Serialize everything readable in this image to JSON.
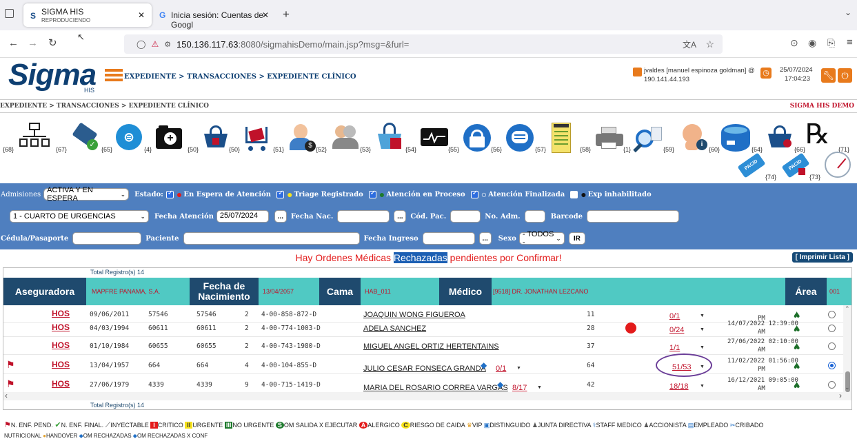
{
  "browser": {
    "tabs": [
      {
        "title": "SIGMA HIS",
        "subtitle": "REPRODUCIENDO"
      },
      {
        "title": "Inicia sesión: Cuentas de Googl"
      }
    ],
    "url_host": "150.136.117.63",
    "url_rest": ":8080/sigmahisDemo/main.jsp?msg=&furl="
  },
  "app": {
    "logo": "Sigma",
    "logo_sub": "HIS",
    "header_breadcrumb": "EXPEDIENTE > TRANSACCIONES > EXPEDIENTE CLÍNICO",
    "user_line1": "jvaldes [manuel espinoza goldman] @",
    "user_line2": "190.141.44.193",
    "date": "25/07/2024",
    "time": "17:04:23",
    "sub_breadcrumb": "EXPEDIENTE > TRANSACCIONES > EXPEDIENTE CLÍNICO",
    "demo_label": "SIGMA HIS DEMO"
  },
  "toolbar": {
    "codes": [
      "{68}",
      "{67}",
      "{65}",
      "{4}",
      "{50}",
      "{50}",
      "{51}",
      "{52}",
      "{53}",
      "{54}",
      "{55}",
      "{56}",
      "{57}",
      "{58}",
      "{1}",
      "{59}",
      "{60}",
      "{64}",
      "{66}",
      "{71}",
      "{74}",
      "{73}"
    ]
  },
  "filters": {
    "admisiones_label": "Admisiones",
    "admisiones_value": "ACTIVA Y EN ESPERA",
    "estado_label": "Estado:",
    "estado_items": [
      "En Espera de Atención",
      "Triage Registrado",
      "Atención en Proceso",
      "Atención Finalizada",
      "Exp inhabilitado"
    ],
    "area_value": "1 - CUARTO DE URGENCIAS",
    "fecha_atencion_label": "Fecha Atención",
    "fecha_atencion_value": "25/07/2024",
    "fecha_nac_label": "Fecha Nac.",
    "cod_pac_label": "Cód. Pac.",
    "no_adm_label": "No. Adm.",
    "barcode_label": "Barcode",
    "cedula_label": "Cédula/Pasaporte",
    "paciente_label": "Paciente",
    "fecha_ingreso_label": "Fecha Ingreso",
    "sexo_label": "Sexo",
    "sexo_value": "- TODOS -",
    "ir_label": "IR",
    "ellipsis": "..."
  },
  "alert": {
    "before": "Hay Ordenes Médicas ",
    "highlight": "Rechazadas",
    "after": " pendientes por Confirmar!"
  },
  "print_label": "[ Imprimir Lista ]",
  "table": {
    "total_top": "Total Registro(s) 14",
    "total_bottom": "Total Registro(s) 14",
    "head": {
      "aseguradora_label": "Aseguradora",
      "aseguradora_value": "MAPFRE PANAMA, S.A.",
      "fecha_label": "Fecha de Nacimiento",
      "fecha_value": "13/04/2057",
      "cama_label": "Cama",
      "cama_value": "HAB_011",
      "medico_label": "Médico",
      "medico_value": "[9518] DR. JONATHAN LEZCANO",
      "area_label": "Área",
      "area_value": "001"
    },
    "rows": [
      {
        "tipo": "HOS",
        "fecha": "09/06/2011",
        "cod": "57546",
        "adm": "57546",
        "n": "2",
        "cedula": "4-00-858-872-D",
        "nombre": "JOAQUIN WONG FIGUEROA",
        "cama": "11",
        "orden": "0/1",
        "fecha_orden": "",
        "fecha_orden2": "PM",
        "flag": false,
        "red_dot": false,
        "selected": false
      },
      {
        "tipo": "HOS",
        "fecha": "04/03/1994",
        "cod": "60611",
        "adm": "60611",
        "n": "2",
        "cedula": "4-00-774-1003-D",
        "nombre": "ADELA SANCHEZ",
        "cama": "28",
        "orden": "0/24",
        "fecha_orden": "14/07/2022 12:39:00",
        "fecha_orden2": "AM",
        "flag": false,
        "red_dot": true,
        "selected": false
      },
      {
        "tipo": "HOS",
        "fecha": "01/10/1984",
        "cod": "60655",
        "adm": "60655",
        "n": "2",
        "cedula": "4-00-743-1980-D",
        "nombre": "MIGUEL ANGEL ORTIZ HERTENTAINS",
        "cama": "37",
        "orden": "1/1",
        "fecha_orden": "27/06/2022 02:10:00",
        "fecha_orden2": "AM",
        "flag": false,
        "red_dot": false,
        "selected": false
      },
      {
        "tipo": "HOS",
        "fecha": "13/04/1957",
        "cod": "664",
        "adm": "664",
        "n": "4",
        "cedula": "4-00-104-855-D",
        "nombre": "JULIO CESAR FONSECA GRANDA",
        "nombre_orden": "0/1",
        "cama": "64",
        "orden": "51/53",
        "fecha_orden": "11/02/2022 01:56:00",
        "fecha_orden2": "PM",
        "flag": true,
        "red_dot": false,
        "selected": true
      },
      {
        "tipo": "HOS",
        "fecha": "27/06/1979",
        "cod": "4339",
        "adm": "4339",
        "n": "9",
        "cedula": "4-00-715-1419-D",
        "nombre": "MARIA DEL ROSARIO CORREA VARGAS",
        "nombre_orden": "8/17",
        "cama": "42",
        "orden": "18/18",
        "fecha_orden": "16/12/2021 09:05:00",
        "fecha_orden2": "AM",
        "flag": true,
        "red_dot": false,
        "selected": false
      }
    ]
  },
  "legend": {
    "items": [
      "N. ENF. PEND.",
      "N. ENF. FINAL.",
      "INYECTABLE",
      "CRITICO",
      "URGENTE",
      "NO URGENTE",
      "OM SALIDA X EJECUTAR",
      "ALERGICO",
      "RIESGO DE CAIDA",
      "VIP",
      "DISTINGUIDO",
      "JUNTA DIRECTIVA",
      "STAFF MEDICO",
      "ACCIONISTA",
      "EMPLEADO",
      "CRIBADO"
    ],
    "line2": [
      "NUTRICIONAL",
      "HANDOVER",
      "OM RECHAZADAS",
      "OM RECHAZADAS X CONF"
    ],
    "badges": {
      "critico": "I",
      "urgente": "II",
      "no_urgente": "III",
      "om_salida": "S",
      "alergico": "A",
      "caida": "C"
    }
  }
}
